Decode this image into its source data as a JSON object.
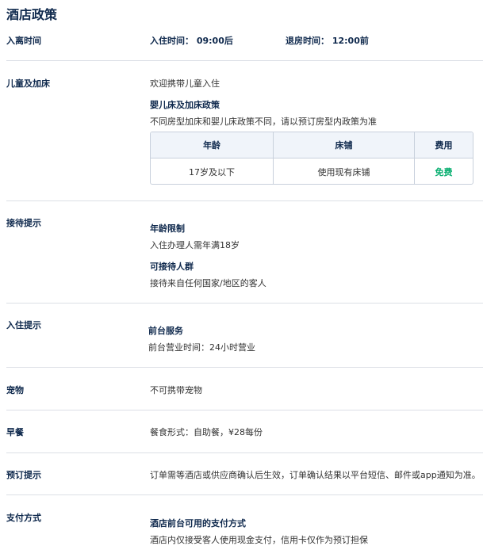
{
  "page": {
    "title": "酒店政策"
  },
  "checkin_time": {
    "label": "入离时间",
    "checkin": "入住时间： 09:00后",
    "checkout": "退房时间： 12:00前"
  },
  "children": {
    "label": "儿童及加床",
    "welcome": "欢迎携带儿童入住",
    "policy_title": "婴儿床及加床政策",
    "policy_note": "不同房型加床和婴儿床政策不同，请以预订房型内政策为准",
    "table": {
      "headers": [
        "年龄",
        "床铺",
        "费用"
      ],
      "rows": [
        [
          "17岁及以下",
          "使用现有床铺",
          "免费"
        ]
      ]
    }
  },
  "reception": {
    "label": "接待提示",
    "age_title": "年龄限制",
    "age_text": "入住办理人需年满18岁",
    "guests_title": "可接待人群",
    "guests_text": "接待来自任何国家/地区的客人"
  },
  "checkin_tips": {
    "label": "入住提示",
    "desk_title": "前台服务",
    "desk_text": "前台营业时间：24小时营业"
  },
  "pets": {
    "label": "宠物",
    "text": "不可携带宠物"
  },
  "breakfast": {
    "label": "早餐",
    "text": "餐食形式：自助餐，¥28每份"
  },
  "booking": {
    "label": "预订提示",
    "text": "订单需等酒店或供应商确认后生效，订单确认结果以平台短信、邮件或app通知为准。"
  },
  "payment": {
    "label": "支付方式",
    "title": "酒店前台可用的支付方式",
    "text": "酒店内仅接受客人使用现金支付，信用卡仅作为预订担保"
  },
  "colors": {
    "heading": "#0f294d",
    "free": "#06ae6f",
    "table_head_bg": "#f0f4fa",
    "divider": "#dcdfe6"
  }
}
